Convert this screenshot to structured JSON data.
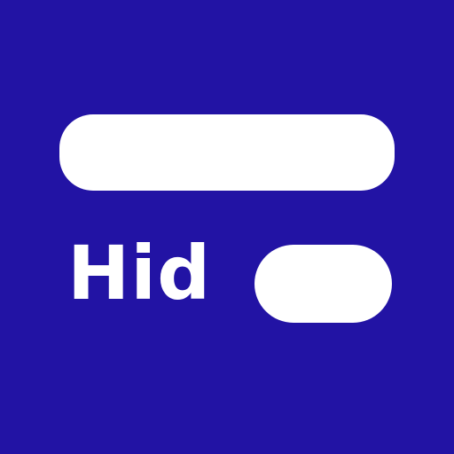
{
  "logo": {
    "text": "Hid",
    "background_color": "#2213a4",
    "foreground_color": "#ffffff"
  }
}
